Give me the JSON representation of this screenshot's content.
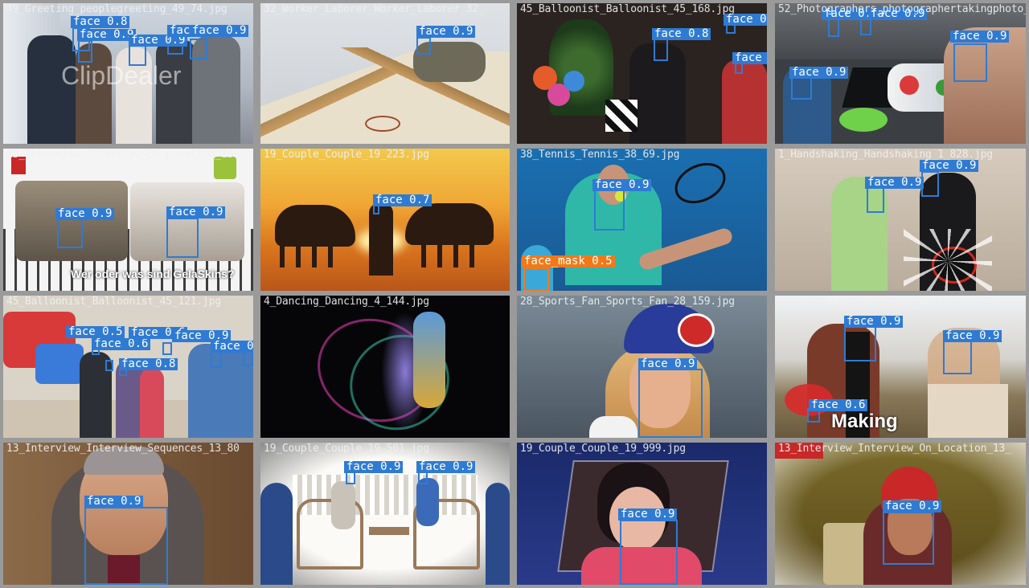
{
  "mosaic": {
    "box_color": "#2f7bd3",
    "mask_color": "#f07a1a",
    "tiles": [
      {
        "name": "49_Greeting_peoplegreeting_49_74.jpg",
        "labels": [
          "face 0.8",
          "face 0.9",
          "face 0.9",
          "face 0.9",
          "face 0.9"
        ]
      },
      {
        "name": "32_Worker_Laborer_Worker_Laborer_32_",
        "labels": [
          "face 0.9"
        ]
      },
      {
        "name": "45_Balloonist_Balloonist_45_168.jpg",
        "labels": [
          "face 0.8",
          "face 0.9",
          "face 0"
        ]
      },
      {
        "name": "52_Photographers_photographertakingphoto_52",
        "labels": [
          "face 0.9",
          "face 0.9",
          "face 0.9",
          "face 0.9"
        ]
      },
      {
        "name": "13_Interview_Interview_On_Location_13",
        "labels": [
          "face 0.9",
          "face 0.9"
        ],
        "overlay": "Wer oder was sind GelaSkins?"
      },
      {
        "name": "19_Couple_Couple_19_223.jpg",
        "labels": [
          "face 0.7"
        ]
      },
      {
        "name": "38_Tennis_Tennis_38_69.jpg",
        "labels": [
          "face 0.9",
          "face_mask 0.5"
        ]
      },
      {
        "name": "1_Handshaking_Handshaking_1_828.jpg",
        "labels": [
          "face 0.9",
          "face 0.9"
        ]
      },
      {
        "name": "45_Balloonist_Balloonist_45_121.jpg",
        "labels": [
          "face 0.5",
          "face 0.6",
          "face 0.6",
          "face 0.8",
          "face 0.9",
          "face 0.9"
        ]
      },
      {
        "name": "4_Dancing_Dancing_4_144.jpg",
        "labels": []
      },
      {
        "name": "28_Sports_Fan_Sports_Fan_28_159.jpg",
        "labels": [
          "face 0.9"
        ]
      },
      {
        "name": "13_Interview_Interview_On_Location_13_",
        "labels": [
          "face 0.9",
          "face 0.9",
          "face 0.6"
        ],
        "overlay": "Making"
      },
      {
        "name": "13_Interview_Interview_Sequences_13_80",
        "labels": [
          "face 0.9"
        ]
      },
      {
        "name": "19_Couple_Couple_19_501.jpg",
        "labels": [
          "face 0.9",
          "face 0.9"
        ]
      },
      {
        "name": "19_Couple_Couple_19_999.jpg",
        "labels": [
          "face 0.9"
        ]
      },
      {
        "name": "13_Interview_Interview_On_Location_13_",
        "labels": [
          "face 0.9"
        ]
      }
    ]
  }
}
